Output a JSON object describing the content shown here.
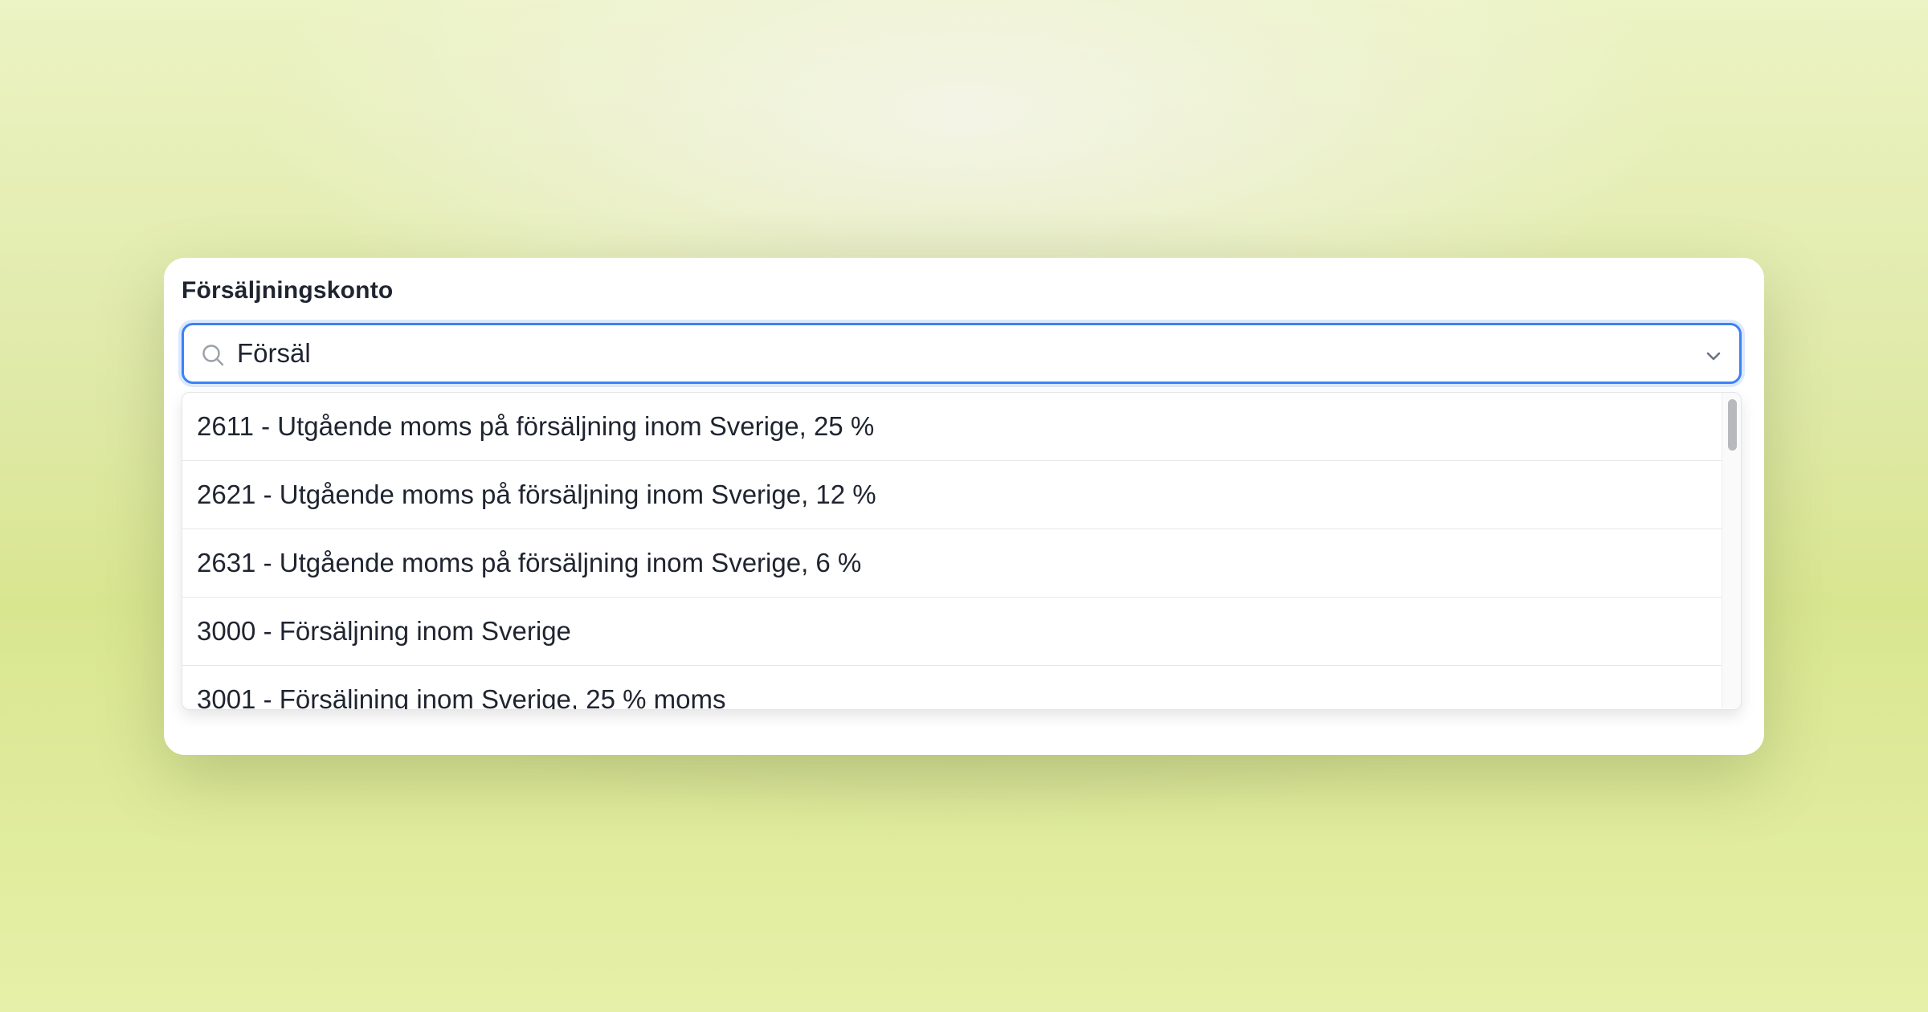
{
  "field": {
    "label": "Försäljningskonto"
  },
  "search": {
    "value": "Försäl",
    "icon": "search-icon",
    "toggle_icon": "chevron-down-icon"
  },
  "dropdown": {
    "options": [
      {
        "label": "2611 - Utgående moms på försäljning inom Sverige, 25 %"
      },
      {
        "label": "2621 - Utgående moms på försäljning inom Sverige, 12 %"
      },
      {
        "label": "2631 - Utgående moms på försäljning inom Sverige, 6 %"
      },
      {
        "label": "3000 - Försäljning inom Sverige"
      },
      {
        "label": "3001 - Försäljning inom Sverige, 25 % moms"
      }
    ]
  },
  "colors": {
    "focus_border": "#3b82f6",
    "text": "#1f2430"
  }
}
